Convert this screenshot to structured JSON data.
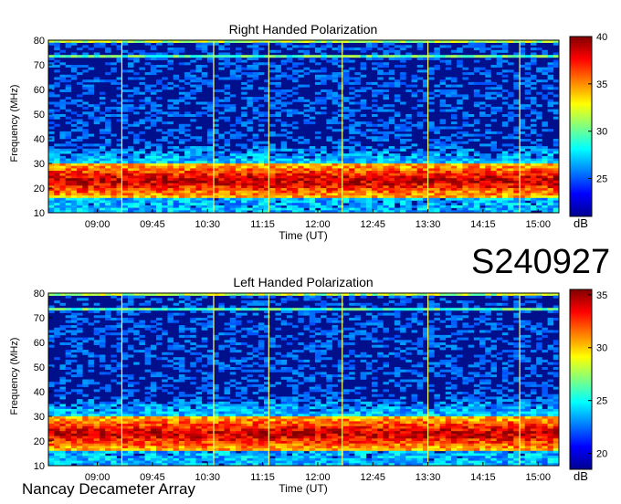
{
  "observation_id": "S240927",
  "instrument": "Nancay Decameter Array",
  "chart_data": [
    {
      "type": "heatmap",
      "title": "Right Handed Polarization",
      "xlabel": "Time (UT)",
      "ylabel": "Frequency (MHz)",
      "x_ticks": [
        "09:00",
        "09:45",
        "10:30",
        "11:15",
        "12:00",
        "12:45",
        "13:30",
        "14:15",
        "15:00"
      ],
      "y_ticks": [
        10,
        20,
        30,
        40,
        50,
        60,
        70,
        80
      ],
      "ylim": [
        10,
        80
      ],
      "xlim": [
        "08:20",
        "15:17"
      ],
      "colorbar": {
        "ticks": [
          25,
          30,
          35,
          40
        ],
        "range": [
          21,
          40
        ],
        "unit": "dB",
        "colormap": "jet"
      },
      "bright_bands_mhz": [
        [
          16,
          30
        ]
      ],
      "vertical_lines": [
        "09:20",
        "10:35",
        "11:20",
        "12:20",
        "13:30",
        "14:45"
      ]
    },
    {
      "type": "heatmap",
      "title": "Left Handed Polarization",
      "xlabel": "Time (UT)",
      "ylabel": "Frequency (MHz)",
      "x_ticks": [
        "09:00",
        "09:45",
        "10:30",
        "11:15",
        "12:00",
        "12:45",
        "13:30",
        "14:15",
        "15:00"
      ],
      "y_ticks": [
        10,
        20,
        30,
        40,
        50,
        60,
        70,
        80
      ],
      "ylim": [
        10,
        80
      ],
      "xlim": [
        "08:20",
        "15:17"
      ],
      "colorbar": {
        "ticks": [
          20,
          25,
          30,
          35
        ],
        "range": [
          18.5,
          35.5
        ],
        "unit": "dB",
        "colormap": "jet"
      },
      "bright_bands_mhz": [
        [
          16,
          30
        ]
      ],
      "vertical_lines": [
        "09:20",
        "10:35",
        "11:20",
        "12:20",
        "13:30",
        "14:45"
      ]
    }
  ],
  "colors": {
    "background_blue": "#000f8c",
    "band_red": "#b40000",
    "band_yellow": "#ffd200",
    "band_cyan": "#28c8ff"
  }
}
